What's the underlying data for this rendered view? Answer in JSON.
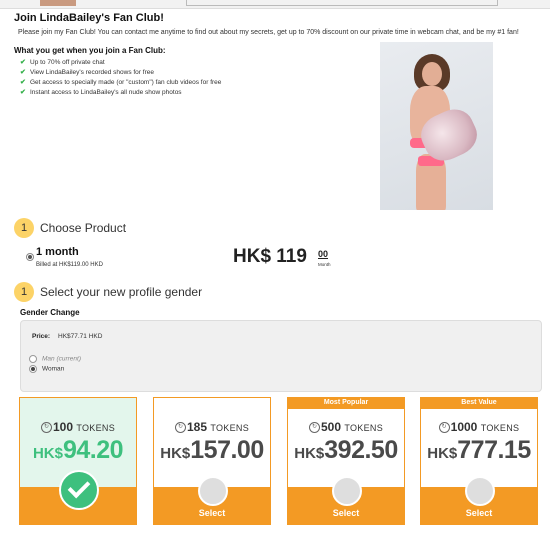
{
  "header": {
    "title": "Join LindaBailey's Fan Club!",
    "intro": "Please join my Fan Club! You can contact me anytime to find out about my secrets, get up to 70% discount on our private time in webcam chat, and be my #1 fan!",
    "what_you_get": "What you get when you join a Fan Club:"
  },
  "benefits": [
    "Up to 70% off private chat",
    "View LindaBailey's recorded shows for free",
    "Get access to specially made (or \"custom\") fan club videos for free",
    "Instant access to LindaBailey's all nude show photos"
  ],
  "step1": {
    "number": "1",
    "label": "Choose Product"
  },
  "product": {
    "name": "1 month",
    "billed": "Billed at HK$119.00 HKD",
    "price_main": "HK$ 119",
    "price_cents": "00",
    "price_unit": "Month"
  },
  "step2": {
    "number": "1",
    "label": "Select your new profile gender"
  },
  "gender": {
    "title": "Gender Change",
    "price_label": "Price:",
    "price_value": "HK$77.71 HKD",
    "options": [
      {
        "label": "Man (current)",
        "selected": false
      },
      {
        "label": "Woman",
        "selected": true
      }
    ]
  },
  "token_packages": [
    {
      "badge": "",
      "tokens": "100",
      "tokens_label": "TOKENS",
      "currency": "HK$",
      "amount": "94.20",
      "action": "",
      "selected": true
    },
    {
      "badge": "",
      "tokens": "185",
      "tokens_label": "TOKENS",
      "currency": "HK$",
      "amount": "157.00",
      "action": "Select",
      "selected": false
    },
    {
      "badge": "Most Popular",
      "tokens": "500",
      "tokens_label": "TOKENS",
      "currency": "HK$",
      "amount": "392.50",
      "action": "Select",
      "selected": false
    },
    {
      "badge": "Best Value",
      "tokens": "1000",
      "tokens_label": "TOKENS",
      "currency": "HK$",
      "amount": "777.15",
      "action": "Select",
      "selected": false
    }
  ],
  "colors": {
    "accent": "#f39a24",
    "selected": "#3ec07e",
    "step_badge": "#fcd367",
    "check": "#35b04a"
  },
  "icons": {
    "benefit": "checkmark-icon",
    "token": "coin-icon",
    "selected": "checkmark-icon"
  }
}
